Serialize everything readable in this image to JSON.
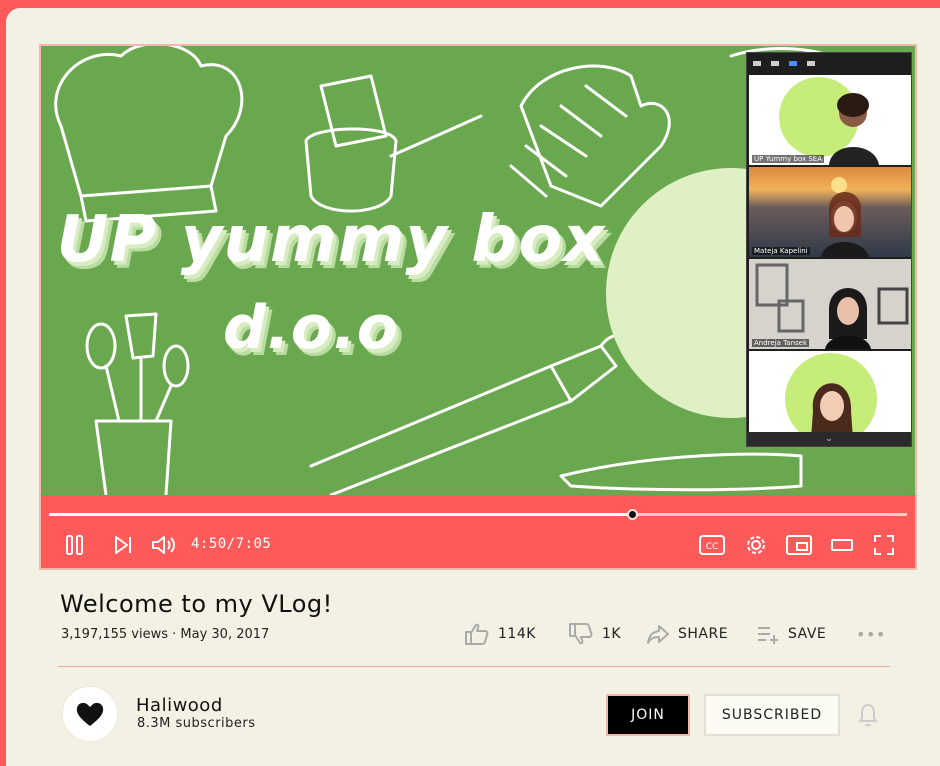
{
  "video": {
    "title_line1": "UP yummy box",
    "title_line2": "d.o.o",
    "meeting": {
      "participants": [
        {
          "name": "UP Yummy box SEA"
        },
        {
          "name": "Mateja Kapelini"
        },
        {
          "name": "Andreja Tansek"
        },
        {
          "name": ""
        }
      ]
    }
  },
  "player": {
    "current_time": "4:50",
    "duration": "7:05",
    "time_display": "4:50/7:05",
    "progress": 0.68,
    "cc_label": "CC",
    "icons": [
      "pause-icon",
      "next-icon",
      "volume-icon",
      "cc-icon",
      "settings-icon",
      "miniplayer-icon",
      "theater-icon",
      "fullscreen-icon"
    ]
  },
  "video_info": {
    "title": "Welcome to my VLog!",
    "meta": "3,197,155 views · May 30, 2017"
  },
  "actions": {
    "like_count": "114K",
    "dislike_count": "1K",
    "share_label": "SHARE",
    "save_label": "SAVE",
    "more_label": "•••"
  },
  "channel": {
    "name": "Haliwood",
    "subscribers": "8.3M subscribers",
    "join_label": "JOIN",
    "subscribed_label": "SUBSCRIBED"
  },
  "colors": {
    "accent": "#ff5a5a",
    "page_bg": "#f3f1e3",
    "video_green": "#6aa84f",
    "light_green": "#dff0c4"
  }
}
